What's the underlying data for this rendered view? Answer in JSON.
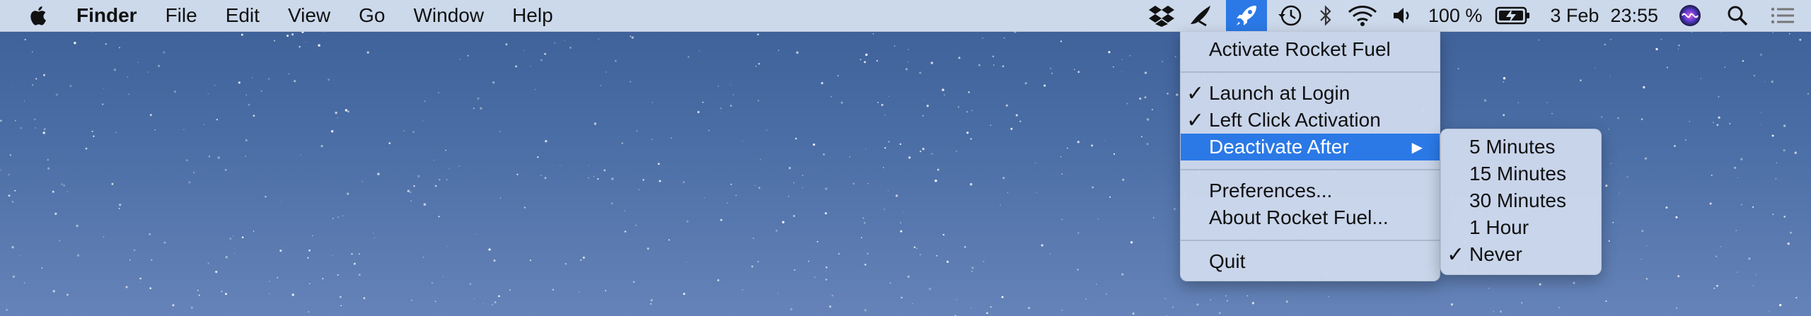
{
  "menubar": {
    "app_name": "Finder",
    "menus": [
      "File",
      "Edit",
      "View",
      "Go",
      "Window",
      "Help"
    ],
    "status": {
      "battery": "100 %",
      "date": "3 Feb",
      "time": "23:55",
      "icons": [
        "dropbox-icon",
        "quill-icon",
        "rocket-fuel-icon",
        "time-machine-icon",
        "bluetooth-icon",
        "wifi-icon",
        "volume-icon",
        "battery-charging-icon",
        "siri-icon",
        "spotlight-search-icon",
        "notification-center-icon"
      ]
    }
  },
  "rocket_menu": {
    "items": [
      {
        "label": "Activate Rocket Fuel",
        "checked": false
      },
      {
        "label": "Launch at Login",
        "checked": true
      },
      {
        "label": "Left Click Activation",
        "checked": true
      },
      {
        "label": "Deactivate After",
        "checked": false,
        "highlighted": true,
        "submenu": true
      },
      {
        "label": "Preferences...",
        "checked": false
      },
      {
        "label": "About Rocket Fuel...",
        "checked": false
      },
      {
        "label": "Quit",
        "checked": false
      }
    ],
    "check_glyph": "✓",
    "submenu_arrow": "▶"
  },
  "deactivate_submenu": {
    "items": [
      {
        "label": "5 Minutes",
        "checked": false
      },
      {
        "label": "15 Minutes",
        "checked": false
      },
      {
        "label": "30 Minutes",
        "checked": false
      },
      {
        "label": "1 Hour",
        "checked": false
      },
      {
        "label": "Never",
        "checked": true
      }
    ]
  },
  "colors": {
    "highlight": "#2b79e6",
    "menubar": "#d6e0f0",
    "desktop": "#4b6ea6"
  }
}
